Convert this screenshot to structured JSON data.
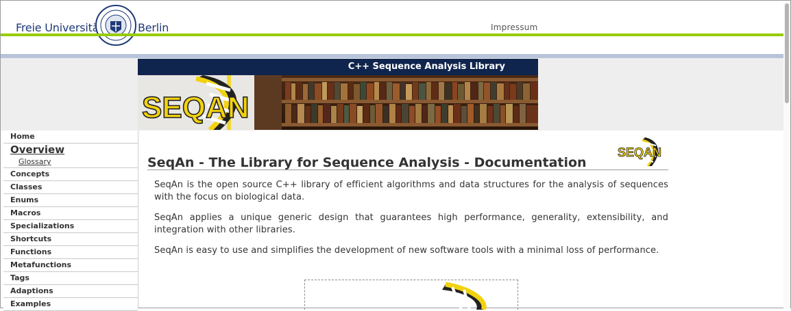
{
  "header": {
    "university_left": "Freie Universität",
    "university_right": "Berlin",
    "impressum": "Impressum"
  },
  "banner": {
    "title": "C++ Sequence Analysis Library",
    "logo_text": "SEQAN"
  },
  "sidebar": {
    "home": "Home",
    "overview": "Overview",
    "glossary": "Glossary",
    "items": [
      "Concepts",
      "Classes",
      "Enums",
      "Macros",
      "Specializations",
      "Shortcuts",
      "Functions",
      "Metafunctions",
      "Tags",
      "Adaptions",
      "Examples"
    ]
  },
  "main": {
    "title": "SeqAn - The Library for Sequence Analysis - Documentation",
    "paragraphs": [
      "SeqAn is the open source C++ library of efficient algorithms and data structures for the analysis of sequences with the focus on biological data.",
      "SeqAn applies a unique generic design that guarantees high performance, generality, extensibility, and integration with other libraries.",
      "SeqAn is easy to use and simplifies the development of new software tools with a minimal loss of performance."
    ],
    "small_logo_text": "SEQAN"
  },
  "colors": {
    "fu_blue": "#1f3a78",
    "fu_green": "#99cc00",
    "banner_navy": "#10254d",
    "logo_yellow": "#f2d20f"
  }
}
